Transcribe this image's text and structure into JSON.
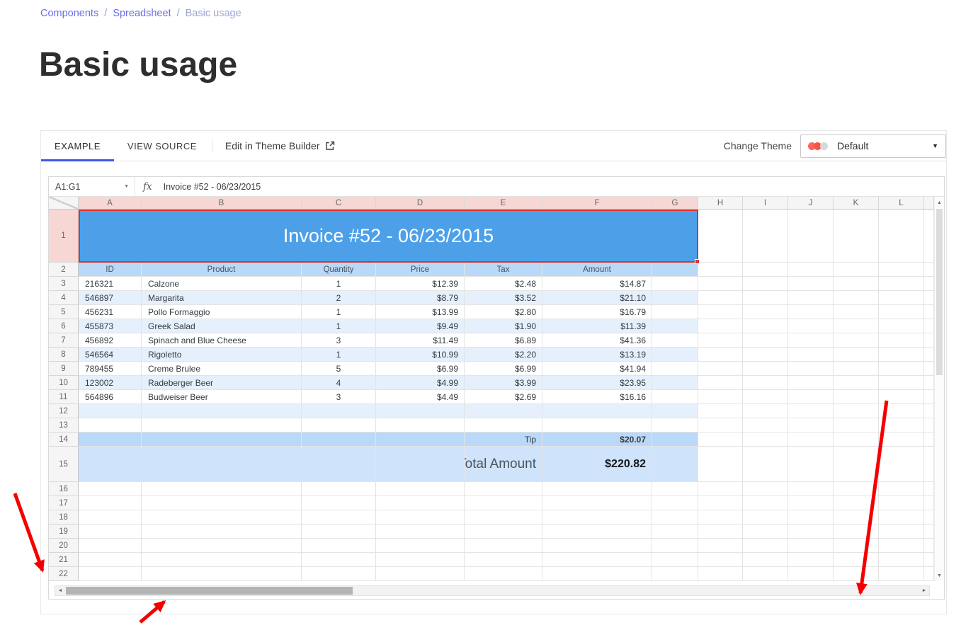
{
  "breadcrumb": {
    "separator": "/",
    "items": [
      {
        "label": "Components"
      },
      {
        "label": "Spreadsheet"
      },
      {
        "label": "Basic usage"
      }
    ]
  },
  "page": {
    "title": "Basic usage"
  },
  "toolbar": {
    "tabs": [
      {
        "label": "EXAMPLE"
      },
      {
        "label": "VIEW SOURCE"
      }
    ],
    "theme_builder_label": "Edit in Theme Builder",
    "change_theme_label": "Change Theme",
    "theme_value": "Default"
  },
  "spreadsheet": {
    "name_box": "A1:G1",
    "fx_label": "fx",
    "formula_value": "Invoice #52 - 06/23/2015",
    "columns": [
      "A",
      "B",
      "C",
      "D",
      "E",
      "F",
      "G",
      "H",
      "I",
      "J",
      "K",
      "L"
    ],
    "visible_row_count": 22,
    "selected_range": "A1:G1",
    "title_cell_text": "Invoice #52 - 06/23/2015",
    "table_headers": [
      "ID",
      "Product",
      "Quantity",
      "Price",
      "Tax",
      "Amount"
    ],
    "data_rows": [
      [
        "216321",
        "Calzone",
        "1",
        "$12.39",
        "$2.48",
        "$14.87"
      ],
      [
        "546897",
        "Margarita",
        "2",
        "$8.79",
        "$3.52",
        "$21.10"
      ],
      [
        "456231",
        "Pollo Formaggio",
        "1",
        "$13.99",
        "$2.80",
        "$16.79"
      ],
      [
        "455873",
        "Greek Salad",
        "1",
        "$9.49",
        "$1.90",
        "$11.39"
      ],
      [
        "456892",
        "Spinach and Blue Cheese",
        "3",
        "$11.49",
        "$6.89",
        "$41.36"
      ],
      [
        "546564",
        "Rigoletto",
        "1",
        "$10.99",
        "$2.20",
        "$13.19"
      ],
      [
        "789455",
        "Creme Brulee",
        "5",
        "$6.99",
        "$6.99",
        "$41.94"
      ],
      [
        "123002",
        "Radeberger Beer",
        "4",
        "$4.99",
        "$3.99",
        "$23.95"
      ],
      [
        "564896",
        "Budweiser Beer",
        "3",
        "$4.49",
        "$2.69",
        "$16.16"
      ]
    ],
    "tip_label": "Tip",
    "tip_value": "$20.07",
    "total_label": "Total Amount",
    "total_value": "$220.82"
  },
  "icons": {
    "dropdown_caret": "▼",
    "name_box_caret": "▼",
    "scroll_up": "▲",
    "scroll_down": "▼",
    "scroll_left": "◄",
    "scroll_right": "►"
  },
  "colors": {
    "breadcrumb_link": "#6a6fdf",
    "tab_underline": "#3e57e8",
    "title_cell_bg": "#4da0e8",
    "band_medium_blue": "#bad9f8",
    "band_light_blue": "#e5f0fc",
    "total_row_bg": "#cfe3fa",
    "selection_border": "#d8352a",
    "selected_header_bg": "#f6d7d4",
    "theme_dot_red": "#ff6358",
    "annotation_arrow": "#f40000"
  }
}
